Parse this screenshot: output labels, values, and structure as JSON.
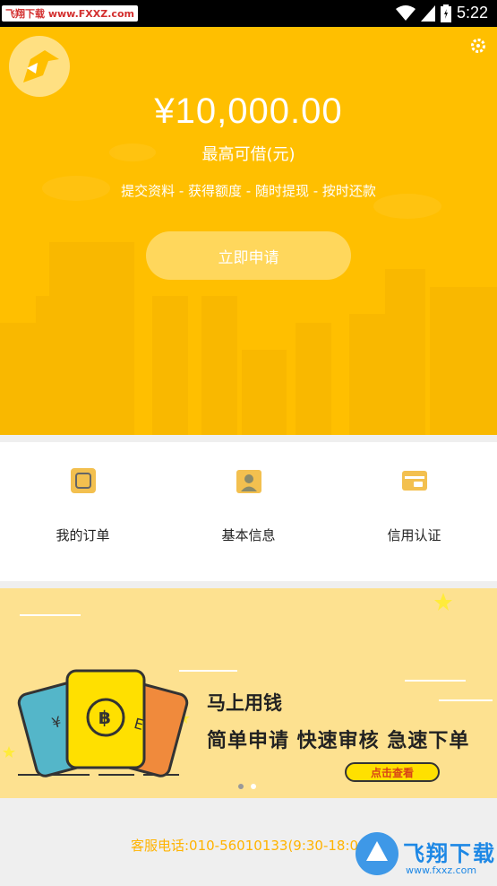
{
  "status": {
    "watermark": "飞翔下载 www.FXXZ.com",
    "time": "5:22"
  },
  "hero": {
    "amount": "¥10,000.00",
    "amount_label": "最高可借(元)",
    "steps": "提交资料 - 获得额度 - 随时提现 - 按时还款",
    "apply_label": "立即申请",
    "colors": {
      "background": "#ffbf00",
      "button": "#ffd75c"
    }
  },
  "menu": {
    "items": [
      {
        "label": "我的订单",
        "icon": "order-icon"
      },
      {
        "label": "基本信息",
        "icon": "profile-icon"
      },
      {
        "label": "信用认证",
        "icon": "credit-card-icon"
      }
    ]
  },
  "banner": {
    "title": "马上用钱",
    "subtitle": "简单申请 快速审核 急速下单",
    "button_label": "点击查看",
    "ticket_symbols": [
      "¥",
      "฿",
      "E"
    ]
  },
  "footer": {
    "phone": "客服电话:010-56010133(9:30-18:0",
    "watermark_cn": "飞翔下载",
    "watermark_url": "www.fxxz.com"
  }
}
